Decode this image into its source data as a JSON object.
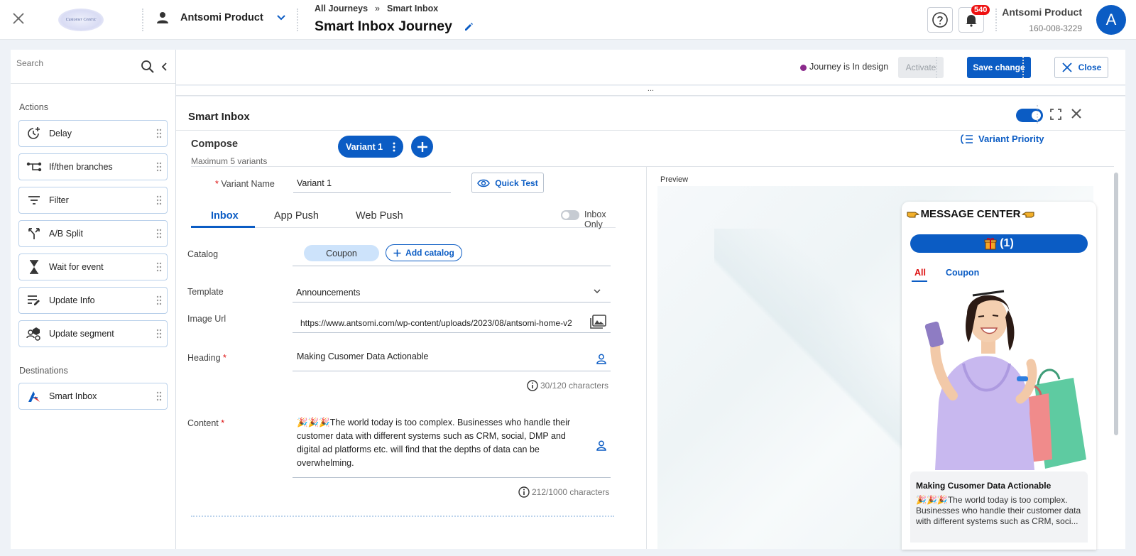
{
  "app": {
    "logo_text": "Customer Centric",
    "account_name": "Antsomi Product"
  },
  "breadcrumb": {
    "parent": "All Journeys",
    "separator": "»",
    "current": "Smart Inbox"
  },
  "page_title": "Smart Inbox Journey",
  "notifications": {
    "count": "540"
  },
  "user": {
    "name": "Antsomi Product",
    "phone": "160-008-3229",
    "avatar_letter": "A"
  },
  "sidebar": {
    "search_placeholder": "Search",
    "actions_label": "Actions",
    "actions": [
      {
        "label": "Delay",
        "icon": "delay-icon"
      },
      {
        "label": "If/then branches",
        "icon": "branch-icon"
      },
      {
        "label": "Filter",
        "icon": "filter-icon"
      },
      {
        "label": "A/B Split",
        "icon": "split-icon"
      },
      {
        "label": "Wait for event",
        "icon": "hourglass-icon"
      },
      {
        "label": "Update Info",
        "icon": "edit-list-icon"
      },
      {
        "label": "Update segment",
        "icon": "segment-icon"
      }
    ],
    "destinations_label": "Destinations",
    "destinations": [
      {
        "label": "Smart Inbox",
        "icon": "smart-inbox-icon"
      }
    ]
  },
  "toolbar": {
    "status_text": "Journey is In design",
    "status_color": "#8b2a8c",
    "activate_label": "Activate",
    "save_label": "Save change",
    "close_label": "Close"
  },
  "grip": "...",
  "panel": {
    "title": "Smart Inbox",
    "enabled": true
  },
  "compose": {
    "title": "Compose",
    "subtitle": "Maximum 5 variants",
    "variant_pill": "Variant 1",
    "variant_priority_label": "Variant Priority"
  },
  "form": {
    "variant_name_label": "Variant Name",
    "variant_name_value": "Variant 1",
    "quick_test_label": "Quick Test",
    "tabs": [
      "Inbox",
      "App Push",
      "Web Push"
    ],
    "active_tab": "Inbox",
    "inbox_only_label": "Inbox Only",
    "catalog_label": "Catalog",
    "catalog_chip": "Coupon",
    "add_catalog_label": "Add catalog",
    "template_label": "Template",
    "template_value": "Announcements",
    "image_url_label": "Image Url",
    "image_url_value": "https://www.antsomi.com/wp-content/uploads/2023/08/antsomi-home-v2",
    "heading_label": "Heading",
    "heading_value": "Making Cusomer Data Actionable",
    "heading_count": "30/120 characters",
    "content_label": "Content",
    "content_value": "🎉🎉🎉The world today is too complex. Businesses who handle their customer data with different systems such as CRM, social, DMP and digital ad platforms etc. will find that the depths of data can be overwhelming.",
    "content_count": "212/1000 characters"
  },
  "preview": {
    "label": "Preview",
    "message_center_title": "MESSAGE CENTER",
    "gift_count": "(1)",
    "tabs": [
      "All",
      "Coupon"
    ],
    "card_heading": "Making Cusomer Data Actionable",
    "card_body": "🎉🎉🎉The world today is too complex. Businesses who handle their customer data with different systems such as CRM, soci..."
  },
  "colors": {
    "primary": "#0b5cc4",
    "badge": "#e11111",
    "required": "#d11111"
  }
}
